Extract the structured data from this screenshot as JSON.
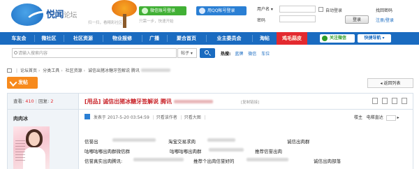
{
  "header": {
    "logo_text": "悦闻",
    "logo_sub": "论坛",
    "slogan": "扫一扫，看精彩社区",
    "wechat_login": "微信账号登录",
    "qq_login": "用QQ帐号登录",
    "login_hint": "只需一步，快速开始",
    "username_label": "用户名",
    "password_label": "密码",
    "auto_login": "自动登录",
    "login_button": "登录",
    "forgot_password": "找回密码",
    "register": "注册/登录"
  },
  "nav": {
    "items": [
      "车友会",
      "微社区",
      "社区资源",
      "物业报修",
      "广播",
      "聚合首页",
      "业主委员会",
      "淘帖",
      "鸡毛蒜皮"
    ],
    "follow_wechat": "关注微信",
    "quick_nav": "快捷导航"
  },
  "search": {
    "placeholder": "请输入搜索内容",
    "type": "帖子",
    "hot_label": "热搜:",
    "hot_keywords": [
      "蓝牌",
      "微信",
      "车位"
    ]
  },
  "breadcrumb": [
    "论坛首页",
    "分类工具",
    "社区资源",
    "诚信出猪冰糖牙签解说 腾讯"
  ],
  "actions": {
    "post": "发帖",
    "back_to_list": "返回列表"
  },
  "thread": {
    "views_label": "查看:",
    "views": "410",
    "replies_label": "回复:",
    "replies": "2",
    "title_tag": "[用品]",
    "title": "诚信出猪冰糖牙签解说 腾讯",
    "copy_link": "[复制链接]",
    "author": "肉肉冰",
    "posted_prefix": "发表于",
    "posted_at": "2017-5-20 03:54:59",
    "only_author": "只看该作者",
    "only_large": "只看大图",
    "floor_label": "楼主",
    "jump_label": "电梯直达",
    "content": [
      [
        "信誉出",
        "淘宝交易求肉",
        "诚信出肉群"
      ],
      [
        "咕嘟咕嘟出肉群微信群",
        "咕嘟咕嘟出肉群",
        "推荐信誉出肉"
      ],
      [
        "信誉真实出肉腾讯:",
        "推荐个出肉信誉好的",
        "诚信出肉部落"
      ]
    ]
  }
}
